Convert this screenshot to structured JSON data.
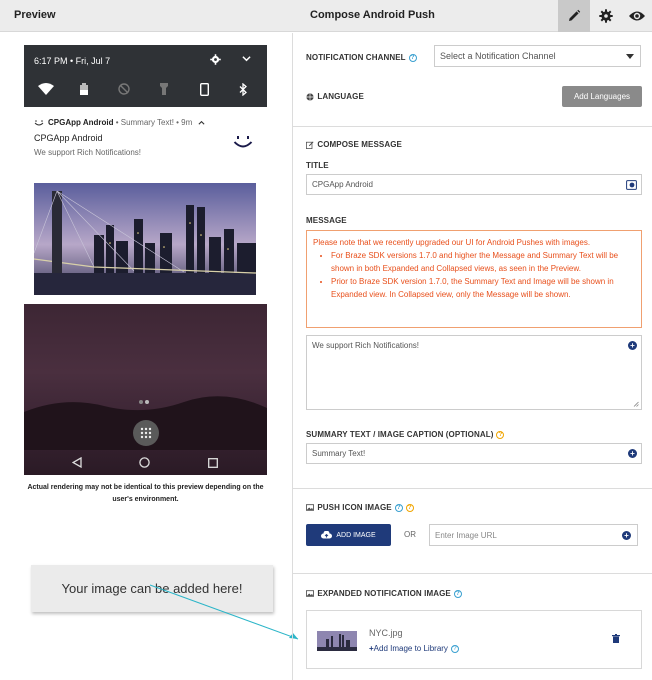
{
  "header": {
    "preview_title": "Preview",
    "compose_title": "Compose Android Push",
    "tools": [
      "pencil-icon",
      "gear-icon",
      "eye-icon"
    ]
  },
  "phone": {
    "status_time": "6:17 PM • Fri, Jul 7",
    "notification": {
      "app_name": "CPGApp Android",
      "meta": " • Summary Text! • 9m",
      "title": "CPGApp Android",
      "message": "We support Rich Notifications!"
    }
  },
  "disclaimer": "Actual rendering may not be identical to this preview depending on the user's environment.",
  "callout": "Your image can be added here!",
  "form": {
    "notification_channel_label": "NOTIFICATION CHANNEL",
    "notification_channel_placeholder": "Select a Notification Channel",
    "language_label": "LANGUAGE",
    "add_languages_button": "Add Languages",
    "compose_message_label": "COMPOSE MESSAGE",
    "title_label": "TITLE",
    "title_value": "CPGApp Android",
    "message_label": "MESSAGE",
    "warning_intro": "Please note that we recently upgraded our UI for Android Pushes with images.",
    "warning_items": [
      "For Braze SDK versions 1.7.0 and higher the Message and Summary Text will be shown in both Expanded and Collapsed views, as seen in the Preview.",
      "Prior to Braze SDK version 1.7.0, the Summary Text and Image will be shown in Expanded view. In Collapsed view, only the Message will be shown."
    ],
    "message_value": "We support Rich Notifications!",
    "summary_label": "SUMMARY TEXT / IMAGE CAPTION (OPTIONAL)",
    "summary_value": "Summary Text!",
    "push_icon_label": "PUSH ICON IMAGE",
    "add_image_button": "ADD IMAGE",
    "or_text": "OR",
    "image_url_placeholder": "Enter Image URL",
    "expanded_label": "EXPANDED NOTIFICATION IMAGE",
    "expanded_filename": "NYC.jpg",
    "add_to_library": "Add Image to Library"
  },
  "colors": {
    "primary": "#1f3a7a",
    "warning": "#e8501c",
    "help": "#3aa0d0",
    "arrow": "#2bb5c8"
  }
}
